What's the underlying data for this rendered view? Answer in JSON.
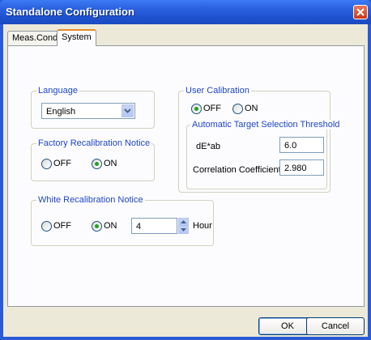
{
  "window": {
    "title": "Standalone Configuration"
  },
  "tabs": [
    {
      "label": "Meas.Cond",
      "active": false
    },
    {
      "label": "System",
      "active": true
    }
  ],
  "language": {
    "group_label": "Language",
    "selected": "English"
  },
  "factory_recalibration": {
    "group_label": "Factory Recalibration Notice",
    "off_label": "OFF",
    "on_label": "ON",
    "selected": "ON"
  },
  "white_recalibration": {
    "group_label": "White Recalibration Notice",
    "off_label": "OFF",
    "on_label": "ON",
    "selected": "ON",
    "hours_value": "4",
    "hours_unit": "Hour"
  },
  "user_calibration": {
    "group_label": "User Calibration",
    "off_label": "OFF",
    "on_label": "ON",
    "selected": "OFF",
    "threshold": {
      "group_label": "Automatic Target Selection Threshold",
      "de_label": "dE*ab",
      "de_value": "6.0",
      "corr_label": "Correlation Coefficient",
      "corr_value": "2.980"
    }
  },
  "footer": {
    "ok_label": "OK",
    "cancel_label": "Cancel"
  },
  "colors": {
    "title_bar": "#2b61e0",
    "group_label": "#1f46c5",
    "radio_dot": "#21a121"
  }
}
